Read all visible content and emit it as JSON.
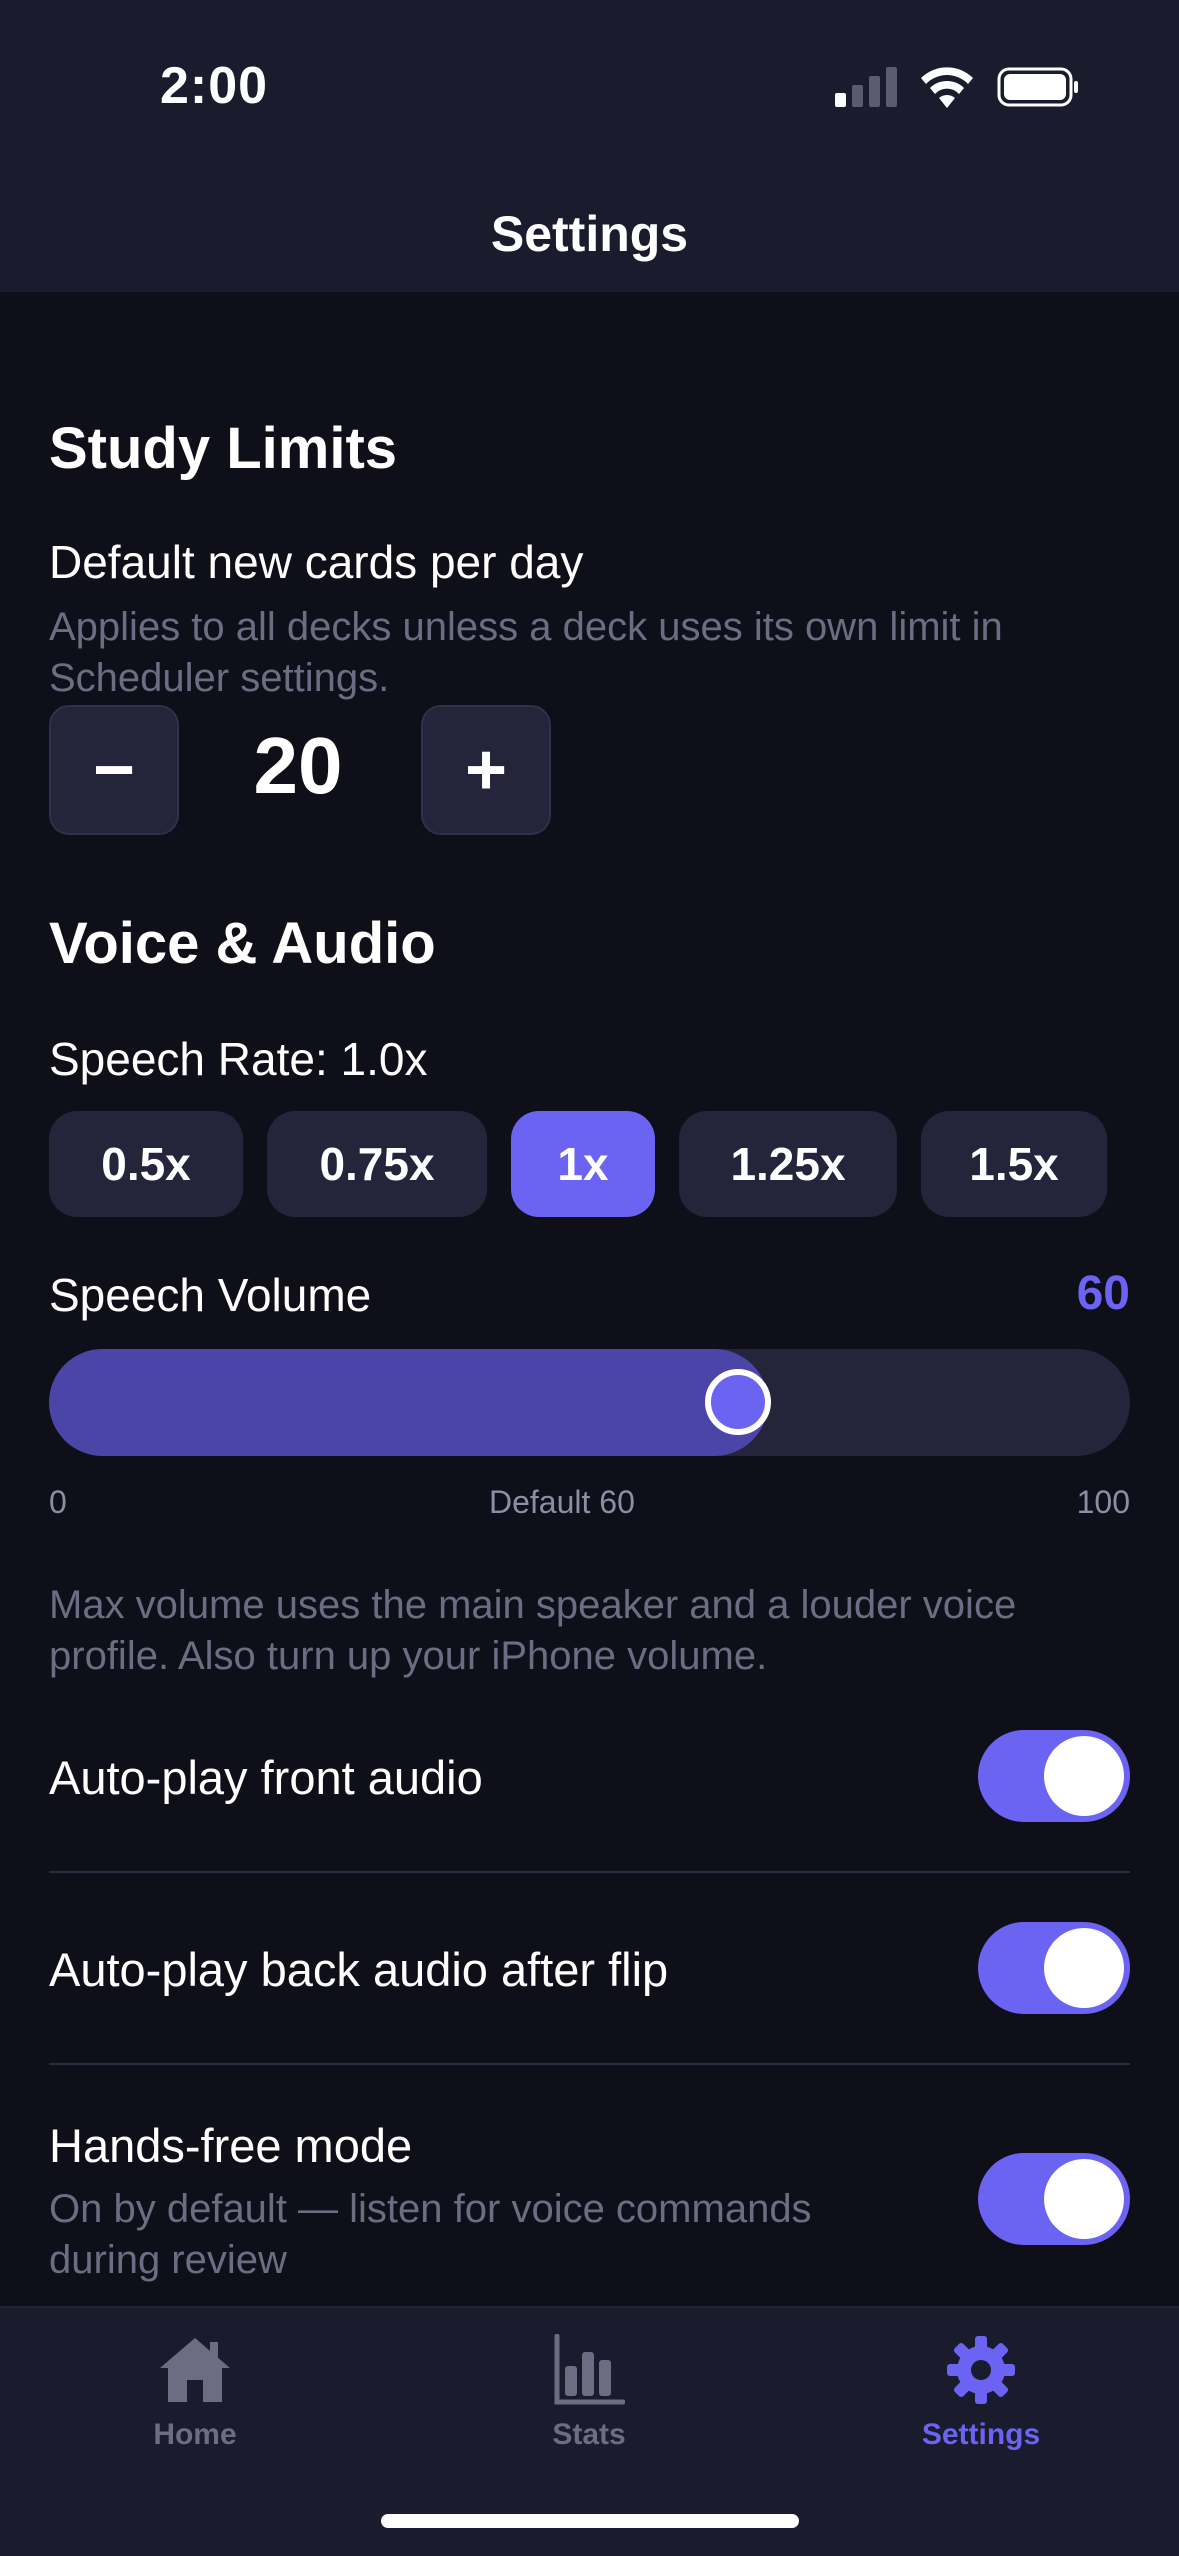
{
  "status_bar": {
    "time": "2:00"
  },
  "header": {
    "title": "Settings"
  },
  "study_limits": {
    "title": "Study Limits",
    "new_cards_label": "Default new cards per day",
    "new_cards_hint": "Applies to all decks unless a deck uses its own limit in Scheduler settings.",
    "decrement": "−",
    "increment": "+",
    "value": "20"
  },
  "voice_audio": {
    "title": "Voice & Audio",
    "speech_rate_label": "Speech Rate: 1.0x",
    "rates": [
      "0.5x",
      "0.75x",
      "1x",
      "1.25x",
      "1.5x"
    ],
    "selected_rate": "1x",
    "volume_label": "Speech Volume",
    "volume_value": "60",
    "volume_level": 0.6,
    "tick_min": "0",
    "tick_default": "Default 60",
    "tick_max": "100",
    "volume_hint": "Max volume uses the main speaker and a louder voice profile. Also turn up your iPhone volume.",
    "autoplay_front": "Auto-play front audio",
    "autoplay_back": "Auto-play back audio after flip",
    "hands_free": "Hands-free mode",
    "hands_free_hint": "On by default — listen for voice commands during review"
  },
  "toggles": {
    "autoplay_front": true,
    "autoplay_back": true,
    "hands_free": true
  },
  "tabbar": {
    "home": "Home",
    "stats": "Stats",
    "settings": "Settings",
    "active": "settings"
  },
  "colors": {
    "accent": "#6b63f2",
    "background": "#0f0f19",
    "header": "#1b1b2e",
    "muted_text": "#6c6c82"
  }
}
